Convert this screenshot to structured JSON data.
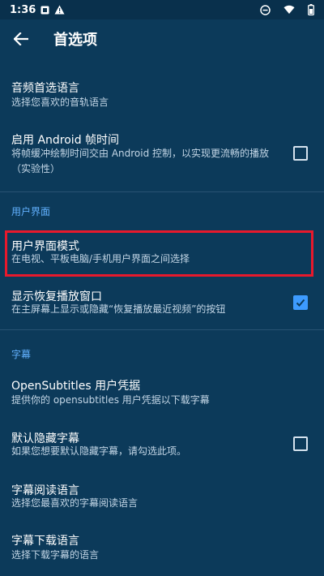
{
  "status_bar": {
    "time": "1:36",
    "left_icons": [
      "notification-square-icon",
      "alert-triangle-icon"
    ],
    "right_icons": [
      "dnd-icon",
      "wifi-icon",
      "battery-icon"
    ]
  },
  "app_bar": {
    "title": "首选项"
  },
  "items": {
    "audio_lang": {
      "title": "音频首选语言",
      "subtitle": "选择您喜欢的音轨语言"
    },
    "android_frame": {
      "title": "启用 Android 帧时间",
      "subtitle": "将帧缓冲绘制时间交由 Android 控制，以实现更流畅的播放（实验性）",
      "checked": false
    },
    "ui_mode": {
      "title": "用户界面模式",
      "subtitle": "在电视、平板电脑/手机用户界面之间选择"
    },
    "resume_window": {
      "title": "显示恢复播放窗口",
      "subtitle": "在主屏幕上显示或隐藏“恢复播放最近视频”的按钮",
      "checked": true
    },
    "opensubtitles": {
      "title": "OpenSubtitles 用户凭据",
      "subtitle": "提供你的 opensubtitles 用户凭据以下载字幕"
    },
    "hide_subs": {
      "title": "默认隐藏字幕",
      "subtitle": "如果您想要默认隐藏字幕，请勾选此项。",
      "checked": false
    },
    "sub_read_lang": {
      "title": "字幕阅读语言",
      "subtitle": "选择您最喜欢的字幕阅读语言"
    },
    "sub_download_lang": {
      "title": "字幕下载语言",
      "subtitle": "选择下载字幕的语言"
    }
  },
  "sections": {
    "ui": "用户界面",
    "subtitles": "字幕"
  },
  "colors": {
    "background": "#0c3a5a",
    "accent": "#3d9bff",
    "section_header": "#62b1ff",
    "highlight_box": "#e8192c"
  }
}
